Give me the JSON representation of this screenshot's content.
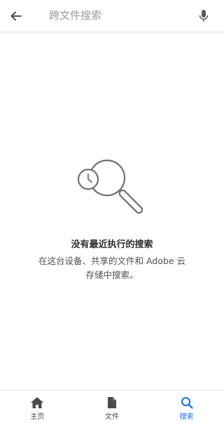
{
  "header": {
    "back_icon": "arrow-left-icon",
    "search_placeholder": "跨文件搜索",
    "search_value": "",
    "mic_icon": "microphone-icon"
  },
  "empty_state": {
    "illustration_icon": "search-history-icon",
    "title": "没有最近执行的搜索",
    "description": "在这台设备、共享的文件和 Adobe 云存储中搜索。"
  },
  "bottom_nav": {
    "items": [
      {
        "label": "主页",
        "icon": "home-icon",
        "active": false
      },
      {
        "label": "文件",
        "icon": "file-icon",
        "active": false
      },
      {
        "label": "搜索",
        "icon": "search-icon",
        "active": true
      }
    ]
  },
  "colors": {
    "accent": "#1473e6",
    "icon_gray": "#5a5a5a",
    "illustration_gray": "#707070"
  }
}
